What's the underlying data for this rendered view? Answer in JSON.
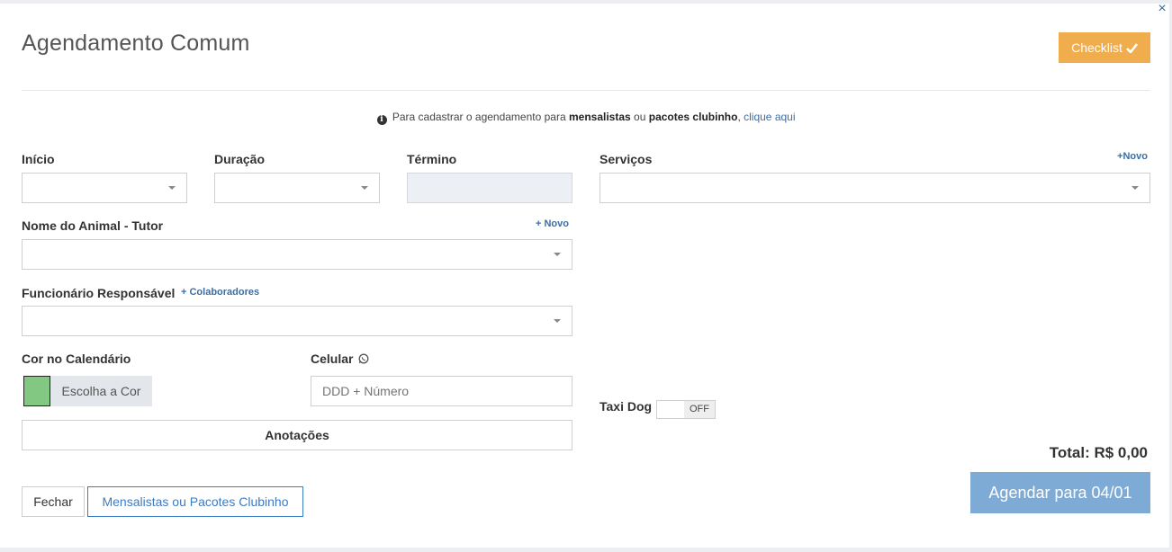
{
  "modal": {
    "title": "Agendamento Comum",
    "close_glyph": "×",
    "checklist_label": "Checklist",
    "checklist_icon": "check-icon"
  },
  "info": {
    "prefix": "Para cadastrar o agendamento para",
    "bold1": "mensalistas",
    "mid": "ou",
    "bold2": "pacotes clubinho",
    "comma": ",",
    "link": "clique aqui"
  },
  "form": {
    "inicio_label": "Início",
    "duracao_label": "Duração",
    "termino_label": "Término",
    "servicos_label": "Serviços",
    "servicos_new": "+Novo",
    "animal_label": "Nome do Animal - Tutor",
    "animal_new": "+ Novo",
    "funcionario_label": "Funcionário Responsável",
    "colaboradores_link": "+ Colaboradores",
    "cor_label": "Cor no Calendário",
    "cor_button": "Escolha a Cor",
    "cor_value": "#82c882",
    "celular_label": "Celular",
    "celular_placeholder": "DDD + Número",
    "anotacoes_label": "Anotações",
    "taxi_label": "Taxi Dog",
    "taxi_state": "OFF"
  },
  "footer": {
    "total": "Total: R$ 0,00",
    "fechar": "Fechar",
    "mensalistas": "Mensalistas ou Pacotes Clubinho",
    "agendar": "Agendar para 04/01"
  },
  "colors": {
    "accent_orange": "#f0ad4e",
    "primary_blue": "#7eabd6",
    "link_blue": "#3c6ea3"
  }
}
